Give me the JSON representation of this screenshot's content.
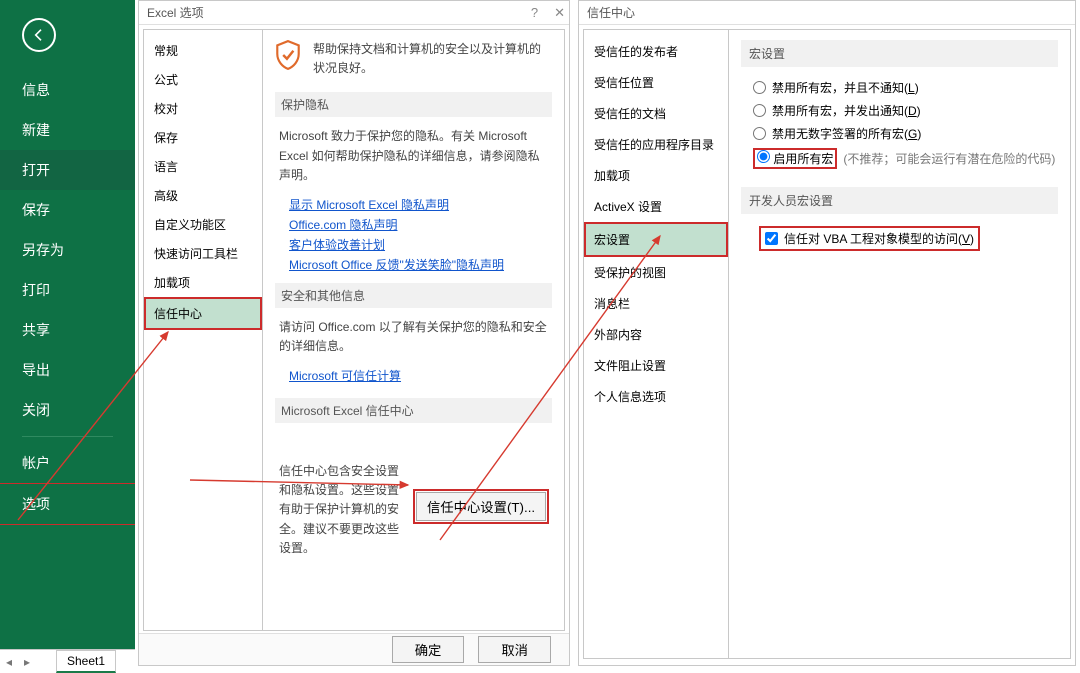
{
  "green_sidebar": {
    "items": [
      {
        "label": "信息"
      },
      {
        "label": "新建"
      },
      {
        "label": "打开",
        "selected": true
      },
      {
        "label": "保存"
      },
      {
        "label": "另存为"
      },
      {
        "label": "打印"
      },
      {
        "label": "共享"
      },
      {
        "label": "导出"
      },
      {
        "label": "关闭"
      }
    ],
    "account": "帐户",
    "options": "选项"
  },
  "sheet_tab": "Sheet1",
  "dlg_left": {
    "title": "Excel 选项",
    "nav": [
      "常规",
      "公式",
      "校对",
      "保存",
      "语言",
      "高级",
      "自定义功能区",
      "快速访问工具栏",
      "加载项",
      "信任中心"
    ],
    "selected_index": 9,
    "shield_text": "帮助保持文档和计算机的安全以及计算机的状况良好。",
    "sec_privacy": "保护隐私",
    "privacy_text": "Microsoft 致力于保护您的隐私。有关 Microsoft Excel 如何帮助保护隐私的详细信息，请参阅隐私声明。",
    "links": [
      "显示 Microsoft Excel 隐私声明",
      "Office.com 隐私声明",
      "客户体验改善计划",
      "Microsoft Office 反馈\"发送笑脸\"隐私声明"
    ],
    "sec_security": "安全和其他信息",
    "security_text": "请访问 Office.com 以了解有关保护您的隐私和安全的详细信息。",
    "trust_link": "Microsoft 可信任计算",
    "sec_trust": "Microsoft Excel 信任中心",
    "trust_text": "信任中心包含安全设置和隐私设置。这些设置有助于保护计算机的安全。建议不要更改这些设置。",
    "trust_btn": "信任中心设置(T)...",
    "ok": "确定",
    "cancel": "取消"
  },
  "dlg_right": {
    "title": "信任中心",
    "nav": [
      "受信任的发布者",
      "受信任位置",
      "受信任的文档",
      "受信任的应用程序目录",
      "加载项",
      "ActiveX 设置",
      "宏设置",
      "受保护的视图",
      "消息栏",
      "外部内容",
      "文件阻止设置",
      "个人信息选项"
    ],
    "selected_index": 6,
    "sec_macro": "宏设置",
    "radios": [
      {
        "label": "禁用所有宏，并且不通知(",
        "key": "L",
        "tail": ")"
      },
      {
        "label": "禁用所有宏，并发出通知(",
        "key": "D",
        "tail": ")"
      },
      {
        "label": "禁用无数字签署的所有宏(",
        "key": "G",
        "tail": ")"
      }
    ],
    "radio_enable_label": "启用所有宏",
    "radio_enable_trail": "(不推荐；可能会运行有潜在危险的代码)",
    "sec_dev": "开发人员宏设置",
    "vba_label": "信任对 VBA 工程对象模型的访问(",
    "vba_key": "V",
    "vba_tail": ")"
  }
}
